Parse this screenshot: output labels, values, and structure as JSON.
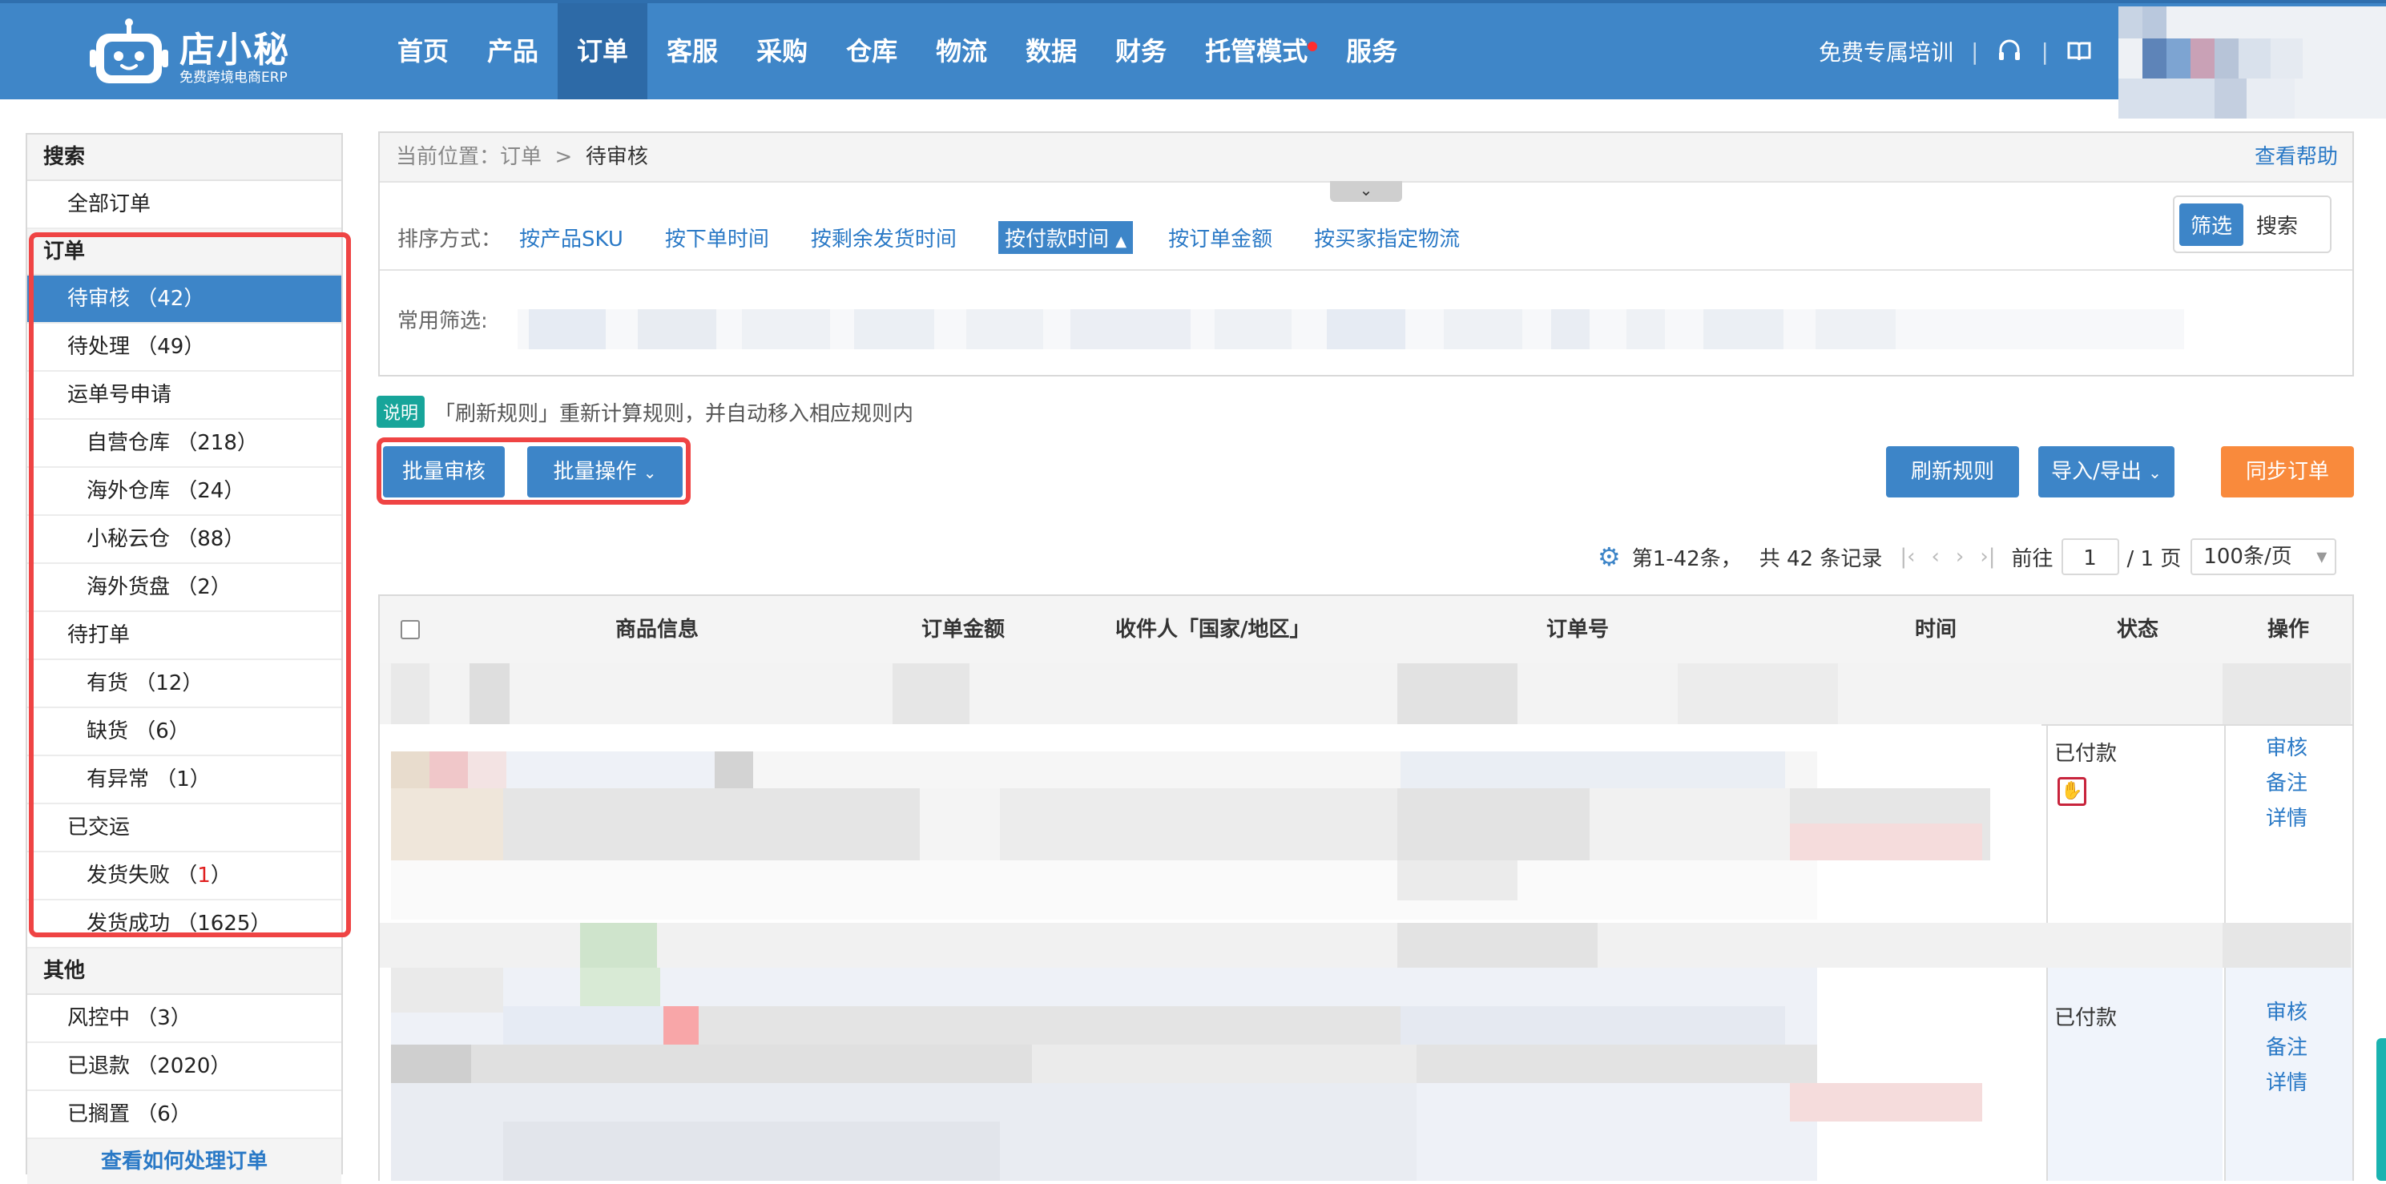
{
  "header": {
    "logo_title": "店小秘",
    "logo_subtitle": "免费跨境电商ERP",
    "nav": [
      {
        "label": "首页",
        "active": false
      },
      {
        "label": "产品",
        "active": false
      },
      {
        "label": "订单",
        "active": true
      },
      {
        "label": "客服",
        "active": false
      },
      {
        "label": "采购",
        "active": false
      },
      {
        "label": "仓库",
        "active": false
      },
      {
        "label": "物流",
        "active": false
      },
      {
        "label": "数据",
        "active": false
      },
      {
        "label": "财务",
        "active": false
      },
      {
        "label": "托管模式",
        "active": false,
        "badge_dot": true
      },
      {
        "label": "服务",
        "active": false
      }
    ],
    "training_link": "免费专属培训",
    "separator": "|",
    "icons": [
      "headset-icon",
      "book-icon"
    ]
  },
  "sidebar": {
    "search_heading": "搜索",
    "all_orders": "全部订单",
    "orders_heading": "订单",
    "items": [
      {
        "label": "待审核 （42）",
        "sub": false,
        "active": true
      },
      {
        "label": "待处理 （49）",
        "sub": false,
        "active": false
      },
      {
        "label": "运单号申请",
        "sub": false,
        "active": false
      },
      {
        "label": "自营仓库 （218）",
        "sub": true,
        "active": false
      },
      {
        "label": "海外仓库 （24）",
        "sub": true,
        "active": false
      },
      {
        "label": "小秘云仓 （88）",
        "sub": true,
        "active": false
      },
      {
        "label": "海外货盘 （2）",
        "sub": true,
        "active": false
      },
      {
        "label": "待打单",
        "sub": false,
        "active": false
      },
      {
        "label": "有货 （12）",
        "sub": true,
        "active": false
      },
      {
        "label": "缺货 （6）",
        "sub": true,
        "active": false
      },
      {
        "label": "有异常 （1）",
        "sub": true,
        "active": false
      },
      {
        "label": "已交运",
        "sub": false,
        "active": false
      }
    ],
    "failed": {
      "prefix": "发货失败 （",
      "count": "1",
      "suffix": "）"
    },
    "success": "发货成功 （1625）",
    "other_heading": "其他",
    "other_items": [
      "风控中 （3）",
      "已退款 （2020）",
      "已搁置 （6）"
    ],
    "howto_link": "查看如何处理订单"
  },
  "breadcrumb": {
    "prefix": "当前位置：订单",
    "sep": ">",
    "current": "待审核",
    "help": "查看帮助"
  },
  "sort": {
    "label": "排序方式：",
    "options": [
      "按产品SKU",
      "按下单时间",
      "按剩余发货时间",
      "按付款时间",
      "按订单金额",
      "按买家指定物流"
    ],
    "active_index": 3,
    "active_arrow": "▲"
  },
  "toggle": {
    "filter": "筛选",
    "search": "搜索"
  },
  "common_filter_label": "常用筛选:",
  "note": {
    "tag": "说明",
    "text": "「刷新规则」重新计算规则，并自动移入相应规则内"
  },
  "buttons": {
    "batch_review": "批量审核",
    "batch_ops": "批量操作",
    "refresh_rules": "刷新规则",
    "import_export": "导入/导出",
    "sync_orders": "同步订单"
  },
  "pagination": {
    "range": "第1-42条，",
    "total": "共 42 条记录",
    "goto": "前往",
    "page": "1",
    "of": "/ 1 页",
    "page_size": "100条/页"
  },
  "table": {
    "headers": [
      "商品信息",
      "订单金额",
      "收件人「国家/地区」",
      "订单号",
      "时间",
      "状态",
      "操作"
    ],
    "rows": [
      {
        "status": "已付款",
        "actions": [
          "审核",
          "备注",
          "详情"
        ],
        "has_pin": true
      },
      {
        "status": "已付款",
        "actions": [
          "审核",
          "备注",
          "详情"
        ],
        "has_pin": false
      }
    ]
  },
  "colors": {
    "brand_blue": "#3f86c8",
    "active_blue": "#3d85c8",
    "highlight_red": "#ef4444",
    "orange": "#f98a3c",
    "teal": "#17a59a"
  }
}
